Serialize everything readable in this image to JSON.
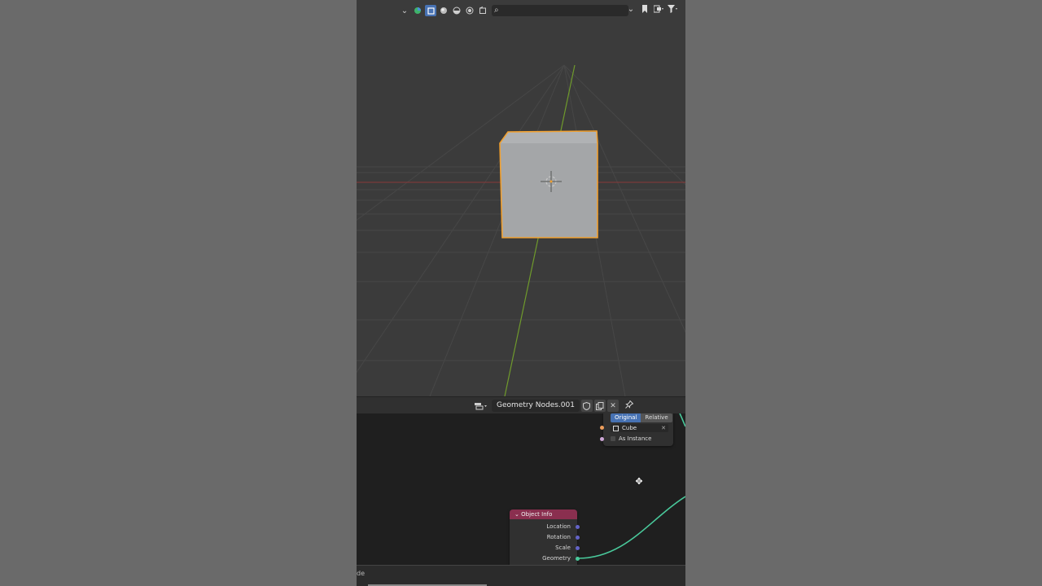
{
  "viewport": {
    "header_icons": [
      "chevron-down-icon",
      "viewport-shading-icon",
      "select-box-icon",
      "solid-sphere-icon",
      "material-sphere-icon",
      "render-sphere-icon",
      "wireframe-icon",
      "search-icon"
    ],
    "right_icons": [
      "chevron-down-icon",
      "bookmark-icon",
      "view-layers-icon",
      "filter-icon"
    ],
    "object_name": "Cube",
    "colors": {
      "selection_outline": "#f0a030",
      "cube_face": "#a3a5a7",
      "x_axis": "#9a3a3a",
      "y_axis": "#6a9a2a"
    }
  },
  "node_editor": {
    "tree_name": "Geometry Nodes.001",
    "header_buttons": [
      "shield-icon",
      "duplicate-icon",
      "close-icon"
    ],
    "pin_icon": "pin-icon",
    "object_info_top": {
      "mode_options": [
        "Original",
        "Relative"
      ],
      "selected_mode": "Original",
      "object_value": "Cube",
      "as_instance_label": "As Instance"
    },
    "object_info": {
      "title": "Object Info",
      "outputs": [
        "Location",
        "Rotation",
        "Scale",
        "Geometry"
      ]
    },
    "colors": {
      "node_header": "#8a2f4f",
      "geometry_link": "#49c99b",
      "vector_socket": "#6363c7",
      "object_socket": "#ed9e5c"
    }
  },
  "footer": {
    "text": "de"
  }
}
